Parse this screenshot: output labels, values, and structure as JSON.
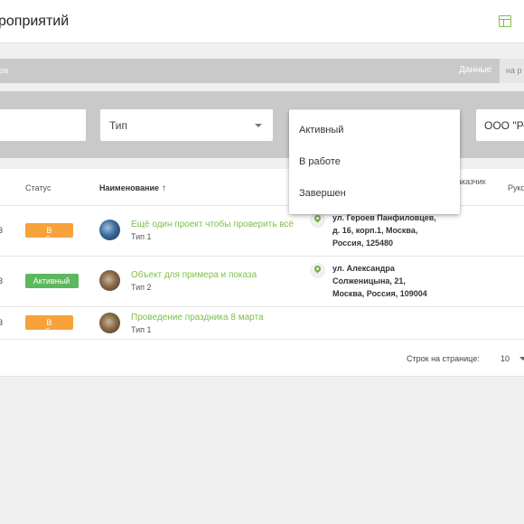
{
  "header": {
    "title": "роприятий",
    "layout_icon": "table-layout-icon"
  },
  "subbar": {
    "left_label": "ра",
    "data_label": "Данные",
    "tab_label": "на р"
  },
  "filters": {
    "type_label": "Тип",
    "client_value": "ООО \"Род"
  },
  "status_menu": {
    "options": [
      "Активный",
      "В работе",
      "Завершен"
    ]
  },
  "table": {
    "columns": {
      "status": "Статус",
      "name": "Наименование",
      "client": "аказчик",
      "manager": "Руко"
    },
    "rows": [
      {
        "id": "3",
        "status": "В работе",
        "name": "Ещё один проект чтобы проверить всё",
        "type": "Тип 1",
        "address_lines": [
          "ул. Героев Панфиловцев,",
          "д. 16, корп.1, Москва,",
          "Россия, 125480"
        ]
      },
      {
        "id": "3",
        "status": "Активный",
        "name": "Объект для примера и показа",
        "type": "Тип 2",
        "address_lines": [
          "ул. Александра",
          "Солженицына, 21,",
          "Москва, Россия, 109004"
        ]
      },
      {
        "id": "3",
        "status": "В работе",
        "name": "Проведение праздника 8 марта",
        "type": "Тип 1"
      }
    ]
  },
  "pagination": {
    "label": "Строк на странице:",
    "value": "10"
  },
  "colors": {
    "accent": "#7cbf4a",
    "status_in_work": "#f7a23b",
    "status_active": "#5cb85c"
  }
}
